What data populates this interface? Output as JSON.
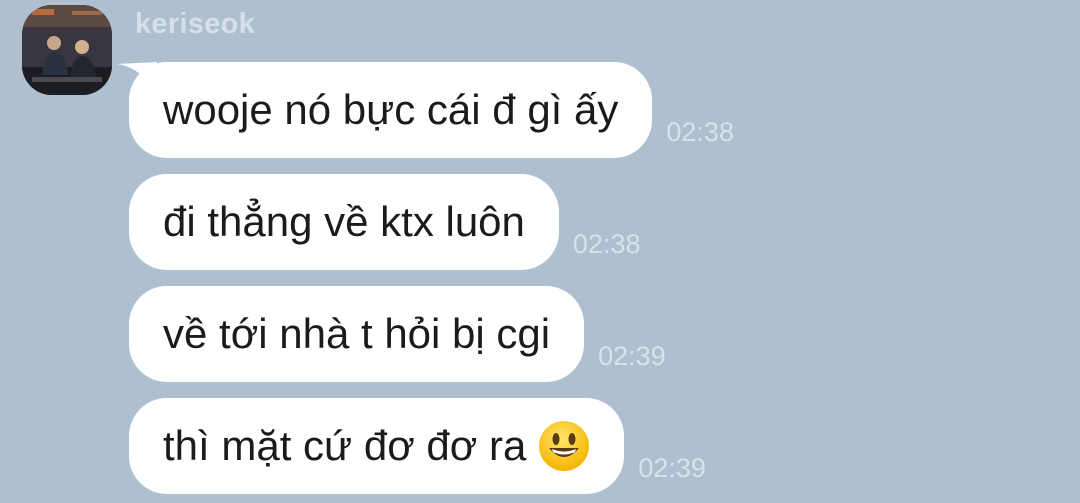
{
  "chat": {
    "sender_name": "keriseok",
    "avatar_icon": "profile-photo-two-people",
    "messages": [
      {
        "text": "wooje nó bực cái đ gì ấy",
        "time": "02:38"
      },
      {
        "text": "đi thẳng về ktx luôn",
        "time": "02:38"
      },
      {
        "text": "về tới nhà t hỏi bị cgi",
        "time": "02:39"
      },
      {
        "text": "thì mặt cứ đơ đơ ra",
        "time": "02:39",
        "emoji": "smiling-face-emoji"
      }
    ]
  },
  "colors": {
    "background": "#aebfd0",
    "bubble": "#ffffff",
    "text": "#1b1b1b",
    "meta_text": "#d9e2ec"
  }
}
